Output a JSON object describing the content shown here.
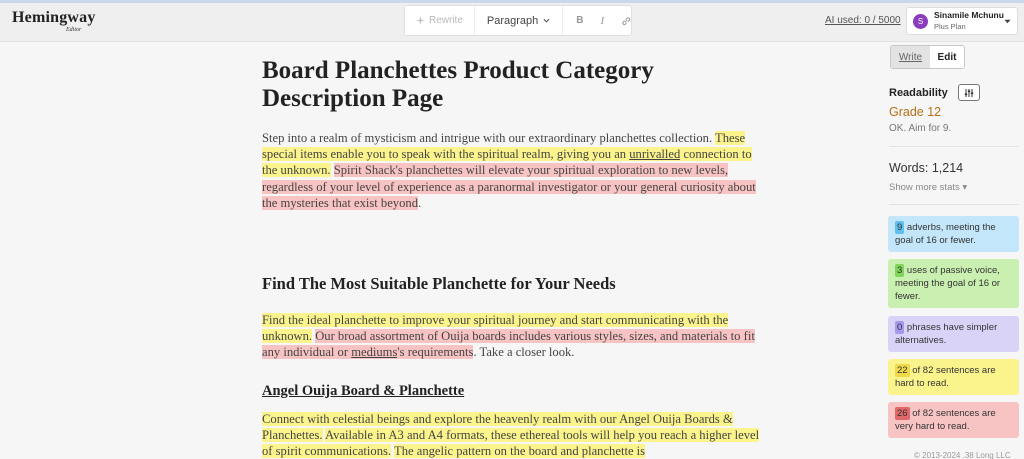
{
  "app": {
    "logo": "Hemingway",
    "logo_sub": "Editor"
  },
  "toolbar": {
    "rewrite": "Rewrite",
    "paragraph": "Paragraph",
    "bold": "B",
    "italic": "I",
    "link": "link"
  },
  "header": {
    "ai_used": "AI used: 0 / 5000"
  },
  "user": {
    "initial": "S",
    "name": "Sinamile Mchunu",
    "plan": "Plus Plan"
  },
  "document": {
    "title": "Board Planchettes Product Category Description Page",
    "p1": [
      {
        "t": "Step into a realm of mysticism and intrigue with our extraordinary planchettes collection. ",
        "c": ""
      },
      {
        "t": "These special items enable you to speak with the spiritual realm, giving you an ",
        "c": "hl-y"
      },
      {
        "t": "unrivalled",
        "c": "hl-y ul"
      },
      {
        "t": " connection to the unknown.",
        "c": "hl-y"
      },
      {
        "t": " ",
        "c": ""
      },
      {
        "t": "Spirit Shack's planchettes will elevate your spiritual exploration to new levels, regardless of your level of experience as a paranormal investigator or your general curiosity about the mysteries that exist beyond",
        "c": "hl-r"
      },
      {
        "t": ".",
        "c": ""
      }
    ],
    "h2": "Find The Most Suitable Planchette for Your Needs",
    "p2": [
      {
        "t": "Find the ideal planchette to improve your spiritual journey and start communicating with the unknown.",
        "c": "hl-y"
      },
      {
        "t": " ",
        "c": ""
      },
      {
        "t": "Our broad assortment of Ouija boards includes various styles, sizes, and materials to fit any individual or ",
        "c": "hl-r"
      },
      {
        "t": "mediums",
        "c": "hl-r ul"
      },
      {
        "t": "'s requirements",
        "c": "hl-r"
      },
      {
        "t": ". Take a closer look.",
        "c": ""
      }
    ],
    "h3": "Angel Ouija Board & Planchette",
    "p3": [
      {
        "t": "Connect with celestial beings and explore the heavenly realm with our Angel Ouija Boards & Planchettes.",
        "c": "hl-y"
      },
      {
        "t": " ",
        "c": ""
      },
      {
        "t": "Available in A3 and A4 formats, these ethereal tools will help you reach a higher level of spirit communications.",
        "c": "hl-y"
      },
      {
        "t": " ",
        "c": ""
      },
      {
        "t": "The angelic pattern on the board and planchette is",
        "c": "hl-y"
      }
    ]
  },
  "sidebar": {
    "write": "Write",
    "edit": "Edit",
    "readability_label": "Readability",
    "grade": "Grade 12",
    "grade_note": "OK. Aim for 9.",
    "words": "Words: 1,214",
    "more_stats": "Show more stats",
    "cards": [
      {
        "num": "9",
        "text": " adverbs, meeting the goal of 16 or fewer."
      },
      {
        "num": "3",
        "text": " uses of passive voice, meeting the goal of 16 or fewer."
      },
      {
        "num": "0",
        "text": " phrases have simpler alternatives."
      },
      {
        "num": "22",
        "text": " of 82 sentences are hard to read."
      },
      {
        "num": "26",
        "text": " of 82 sentences are very hard to read."
      }
    ],
    "copyright": "© 2013-2024 .38 Long LLC"
  },
  "colors": {
    "yellow_highlight": "#fbf48c",
    "red_highlight": "#f8c3c3",
    "grade": "#b76f14",
    "avatar": "#8b3dbf"
  }
}
